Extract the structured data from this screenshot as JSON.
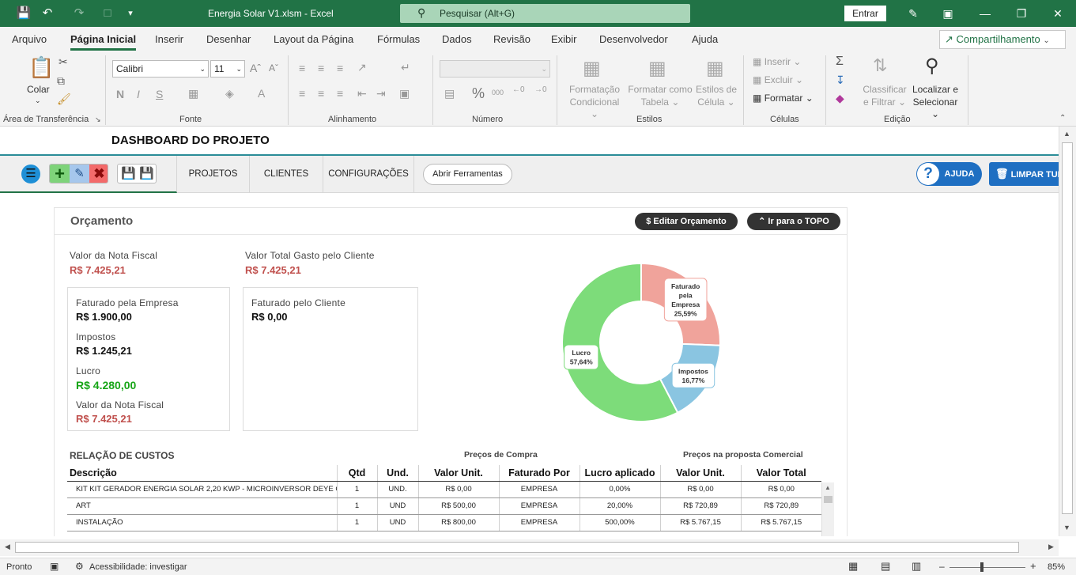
{
  "titlebar": {
    "title": "Energia Solar V1.xlsm  -  Excel",
    "search_placeholder": "Pesquisar (Alt+G)",
    "signin_label": "Entrar"
  },
  "menu": {
    "tabs": [
      "Arquivo",
      "Página Inicial",
      "Inserir",
      "Desenhar",
      "Layout da Página",
      "Fórmulas",
      "Dados",
      "Revisão",
      "Exibir",
      "Desenvolvedor",
      "Ajuda"
    ],
    "active_tab": "Página Inicial",
    "share_label": "Compartilhamento"
  },
  "ribbon": {
    "clipboard": {
      "paste_label": "Colar",
      "group_label": "Área de Transferência"
    },
    "font": {
      "font_name": "Calibri",
      "font_size": "11",
      "group_label": "Fonte"
    },
    "alignment": {
      "group_label": "Alinhamento"
    },
    "number": {
      "group_label": "Número"
    },
    "styles": {
      "conditional_line1": "Formatação",
      "conditional_line2": "Condicional",
      "format_table_line1": "Formatar como",
      "format_table_line2": "Tabela",
      "cell_styles_line1": "Estilos de",
      "cell_styles_line2": "Célula",
      "group_label": "Estilos"
    },
    "cells": {
      "insert_label": "Inserir",
      "delete_label": "Excluir",
      "format_label": "Formatar",
      "group_label": "Células"
    },
    "editing": {
      "sort_line1": "Classificar",
      "sort_line2": "e Filtrar",
      "find_line1": "Localizar e",
      "find_line2": "Selecionar",
      "group_label": "Edição"
    }
  },
  "dashboard": {
    "title": "DASHBOARD DO PROJETO",
    "nav": {
      "projects": "PROJETOS",
      "clients": "CLIENTES",
      "settings": "CONFIGURAÇÕES",
      "open_tools": "Abrir Ferramentas",
      "help": "AJUDA",
      "clear": "LIMPAR TUDO"
    },
    "budget": {
      "heading": "Orçamento",
      "edit_button": "$ Editar Orçamento",
      "top_button": "Ir para o TOPO",
      "invoice_label": "Valor da Nota Fiscal",
      "invoice_value": "R$ 7.425,21",
      "client_total_label": "Valor Total Gasto pelo Cliente",
      "client_total_value": "R$ 7.425,21",
      "company_billed_label": "Faturado pela Empresa",
      "company_billed_value": "R$ 1.900,00",
      "taxes_label": "Impostos",
      "taxes_value": "R$ 1.245,21",
      "profit_label": "Lucro",
      "profit_value": "R$ 4.280,00",
      "invoice2_label": "Valor da Nota Fiscal",
      "invoice2_value": "R$ 7.425,21",
      "client_billed_label": "Faturado pelo Cliente",
      "client_billed_value": "R$ 0,00"
    },
    "costs": {
      "heading": "RELAÇÃO DE CUSTOS",
      "purchase_prices": "Preços de Compra",
      "proposal_prices": "Preços na proposta Comercial",
      "columns": [
        "Descrição",
        "Qtd",
        "Und.",
        "Valor Unit.",
        "Faturado Por",
        "Lucro aplicado",
        "Valor Unit.",
        "Valor Total"
      ],
      "rows": [
        [
          "KIT KIT GERADOR ENERGIA SOLAR 2,20 KWP - MICROINVERSOR DEYE C/ WI",
          "1",
          "UND.",
          "R$ 0,00",
          "EMPRESA",
          "0,00%",
          "R$ 0,00",
          "R$ 0,00"
        ],
        [
          "ART",
          "1",
          "UND",
          "R$ 500,00",
          "EMPRESA",
          "20,00%",
          "R$ 720,89",
          "R$ 720,89"
        ],
        [
          "INSTALAÇÃO",
          "1",
          "UND",
          "R$ 800,00",
          "EMPRESA",
          "500,00%",
          "R$ 5.767,15",
          "R$ 5.767,15"
        ]
      ]
    }
  },
  "chart_data": {
    "type": "pie",
    "donut": true,
    "title": "",
    "slices": [
      {
        "label": "Faturado pela Empresa",
        "value": 25.59,
        "display": "25,59%",
        "color": "#f0a39b"
      },
      {
        "label": "Impostos",
        "value": 16.77,
        "display": "16,77%",
        "color": "#8ac5e1"
      },
      {
        "label": "Lucro",
        "value": 57.64,
        "display": "57,64%",
        "color": "#7ddc7a"
      }
    ]
  },
  "status": {
    "ready": "Pronto",
    "accessibility": "Acessibilidade: investigar",
    "zoom": "85%"
  }
}
